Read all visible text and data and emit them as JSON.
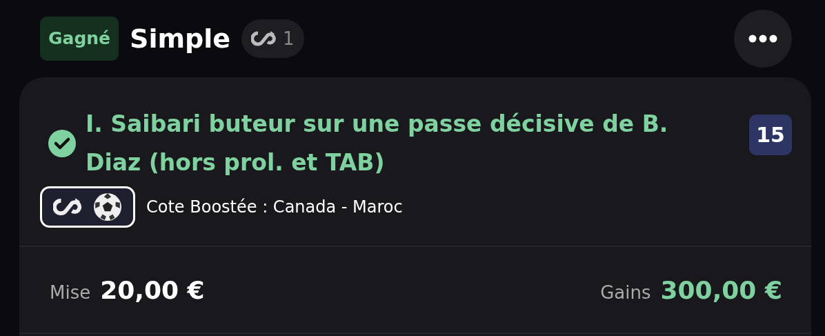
{
  "header": {
    "status": {
      "label": "Gagné",
      "kind": "won"
    },
    "title": "Simple",
    "boost_count": "1"
  },
  "selection": {
    "title": "I. Saibari buteur sur une passe décisive de B. Diaz (hors prol. et TAB)",
    "won": true,
    "odds": "15",
    "event": "Cote Boostée : Canada - Maroc"
  },
  "footer": {
    "stake_label": "Mise",
    "stake": "20,00 €",
    "gains_label": "Gains",
    "gains": "300,00 €"
  }
}
